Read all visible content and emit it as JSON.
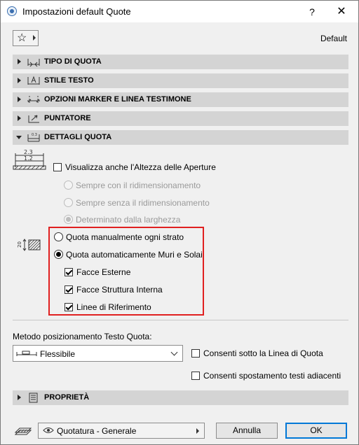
{
  "window": {
    "title": "Impostazioni default Quote",
    "help_label": "?",
    "close_label": "✕"
  },
  "favorites": {
    "icon": "star-icon",
    "default_label": "Default"
  },
  "sections": [
    {
      "label": "TIPO DI QUOTA",
      "expanded": false,
      "icon": "dimension-type-icon"
    },
    {
      "label": "STILE TESTO",
      "expanded": false,
      "icon": "text-style-icon"
    },
    {
      "label": "OPZIONI MARKER E LINEA TESTIMONE",
      "expanded": false,
      "icon": "marker-witness-line-icon"
    },
    {
      "label": "PUNTATORE",
      "expanded": false,
      "icon": "pointer-icon"
    },
    {
      "label": "DETTAGLI QUOTA",
      "expanded": true,
      "icon": "dimension-details-icon"
    }
  ],
  "details": {
    "icon_numbers": {
      "top": "2.3",
      "bottom": "1.2"
    },
    "show_opening_height": {
      "label": "Visualizza anche l'Altezza delle Aperture",
      "checked": false
    },
    "opening_options": [
      {
        "label": "Sempre con il ridimensionamento",
        "checked": false
      },
      {
        "label": "Sempre senza il ridimensionamento",
        "checked": false
      },
      {
        "label": "Determinato dalla larghezza",
        "checked": true
      }
    ],
    "side_icon_number": "20",
    "layer_mode": [
      {
        "label": "Quota manualmente ogni strato",
        "checked": false
      },
      {
        "label": "Quota automaticamente Muri e Solai",
        "checked": true
      }
    ],
    "auto_options": [
      {
        "label": "Facce Esterne",
        "checked": true
      },
      {
        "label": "Facce Struttura Interna",
        "checked": true
      },
      {
        "label": "Linee di Riferimento",
        "checked": true
      }
    ]
  },
  "placement": {
    "label": "Metodo posizionamento Testo Quota:",
    "selected": "Flessibile",
    "below_line": {
      "label": "Consenti sotto la Linea di Quota",
      "checked": false
    },
    "move_adjacent": {
      "label": "Consenti spostamento testi adiacenti",
      "checked": false
    }
  },
  "properties_section": {
    "label": "PROPRIETÀ",
    "expanded": false,
    "icon": "document-icon"
  },
  "footer": {
    "view_label": "Quotatura - Generale",
    "cancel_label": "Annulla",
    "ok_label": "OK"
  },
  "colors": {
    "highlight": "#e02020",
    "section_bg": "#d4d4d4",
    "dialog_bg": "#f0f0f0",
    "ok_border": "#0078d7"
  }
}
